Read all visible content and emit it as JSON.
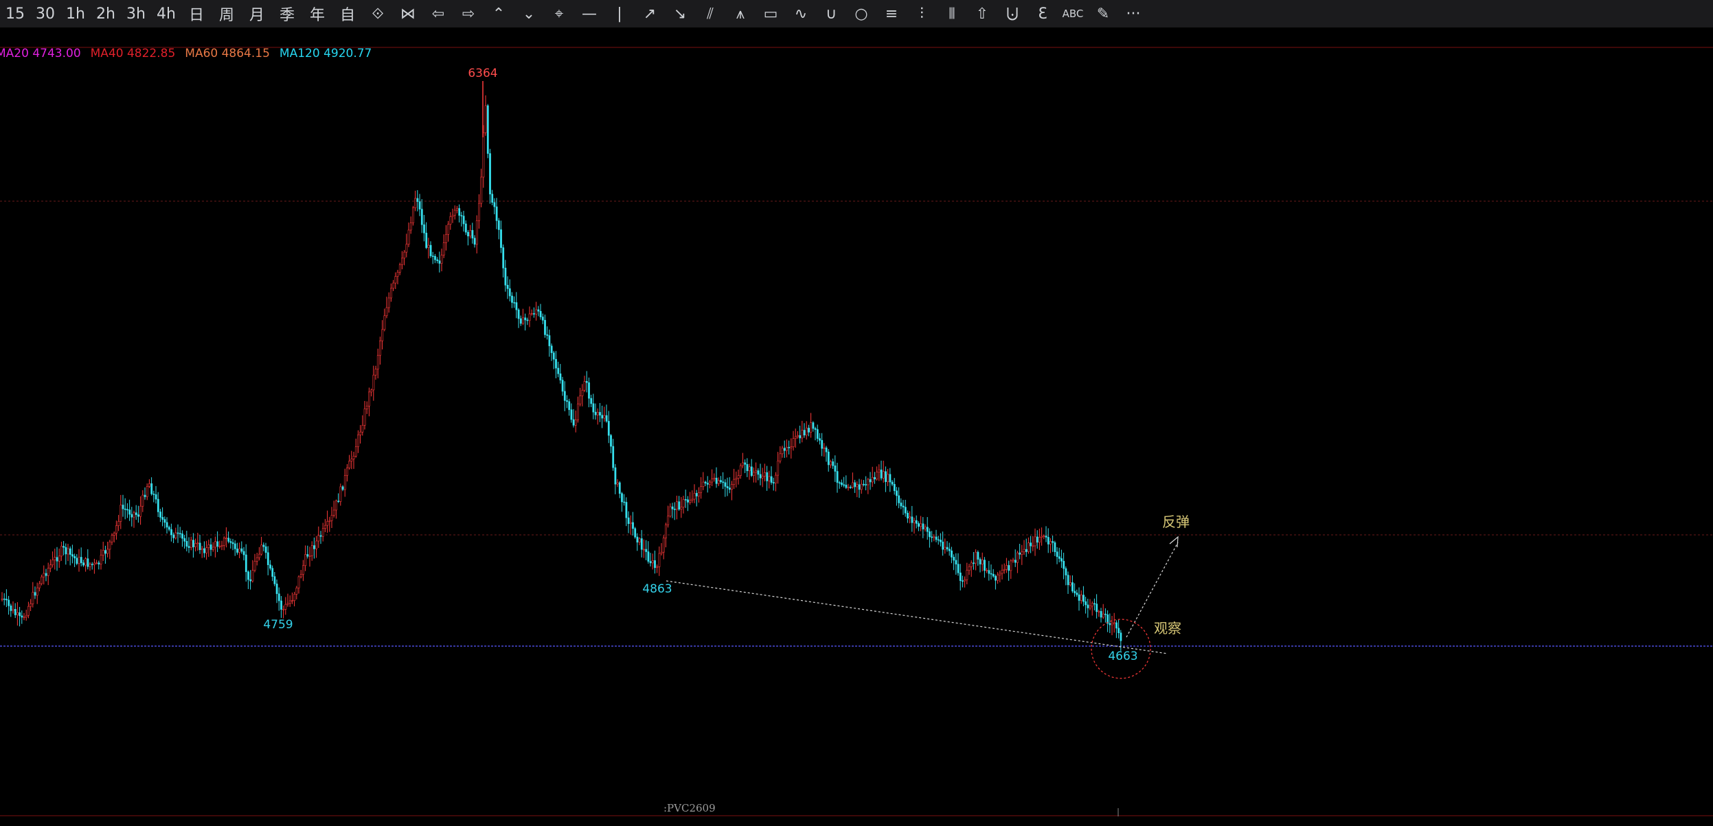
{
  "toolbar": {
    "periods": [
      "15",
      "30",
      "1h",
      "2h",
      "3h",
      "4h",
      "日",
      "周",
      "月",
      "季",
      "年",
      "自"
    ],
    "tools": [
      {
        "name": "zoom-in-out-icon",
        "glyph": "⟐"
      },
      {
        "name": "zoom-fit-icon",
        "glyph": "⋈"
      },
      {
        "name": "arrow-left-icon",
        "glyph": "⇦"
      },
      {
        "name": "arrow-right-icon",
        "glyph": "⇨"
      },
      {
        "name": "chevron-up-double-icon",
        "glyph": "⌃"
      },
      {
        "name": "chevron-down-double-icon",
        "glyph": "⌄"
      },
      {
        "name": "crosshair-cursor-icon",
        "glyph": "⌖"
      },
      {
        "name": "horizontal-line-icon",
        "glyph": "—"
      },
      {
        "name": "vertical-line-icon",
        "glyph": "|"
      },
      {
        "name": "trend-line-icon",
        "glyph": "↗"
      },
      {
        "name": "ray-line-icon",
        "glyph": "↘"
      },
      {
        "name": "parallel-channel-icon",
        "glyph": "⫽"
      },
      {
        "name": "zigzag-line-icon",
        "glyph": "⩚"
      },
      {
        "name": "rectangle-icon",
        "glyph": "▭"
      },
      {
        "name": "wave-line-icon",
        "glyph": "∿"
      },
      {
        "name": "arc-icon",
        "glyph": "∪"
      },
      {
        "name": "circle-icon",
        "glyph": "○"
      },
      {
        "name": "fibonacci-icon",
        "glyph": "≡"
      },
      {
        "name": "gann-fan-icon",
        "glyph": "⫶"
      },
      {
        "name": "cycle-lines-icon",
        "glyph": "⦀"
      },
      {
        "name": "up-arrow-mark-icon",
        "glyph": "⇧"
      },
      {
        "name": "measure-icon",
        "glyph": "⨃"
      },
      {
        "name": "elliott-wave-icon",
        "glyph": "Ɛ"
      },
      {
        "name": "text-abc-icon",
        "glyph": "ABC"
      },
      {
        "name": "eraser-icon",
        "glyph": "✎"
      },
      {
        "name": "more-icon",
        "glyph": "···"
      }
    ]
  },
  "legend": [
    {
      "label": "MA20",
      "value": "4743.00",
      "color": "#e020e0"
    },
    {
      "label": "MA40",
      "value": "4822.85",
      "color": "#e0202a"
    },
    {
      "label": "MA60",
      "value": "4864.15",
      "color": "#e87845"
    },
    {
      "label": "MA120",
      "value": "4920.77",
      "color": "#27d6f0"
    }
  ],
  "annotations": {
    "peak": "6364",
    "low_left": "4759",
    "low_mid": "4863",
    "low_right": "4663",
    "rebound": "反弹",
    "watch": "观察"
  },
  "instrument": ":PVC2609",
  "colors": {
    "up": "#ff3a3a",
    "down": "#36e0ee",
    "label_cyan": "#34d2ea",
    "label_red": "#ff4d4d",
    "label_yellow": "#d8c877",
    "support_line": "#4a4ad8",
    "red_dashed": "#6a1a1a",
    "border_red": "#7a1010"
  },
  "chart_data": {
    "type": "candlestick",
    "labels": [
      "6364",
      "4759",
      "4863",
      "4663"
    ],
    "series": [
      {
        "name": "MA20",
        "value": 4743.0
      },
      {
        "name": "MA40",
        "value": 4822.85
      },
      {
        "name": "MA60",
        "value": 4864.15
      },
      {
        "name": "MA120",
        "value": 4920.77
      }
    ],
    "extremes": {
      "high": 6364,
      "low": 4663
    }
  }
}
